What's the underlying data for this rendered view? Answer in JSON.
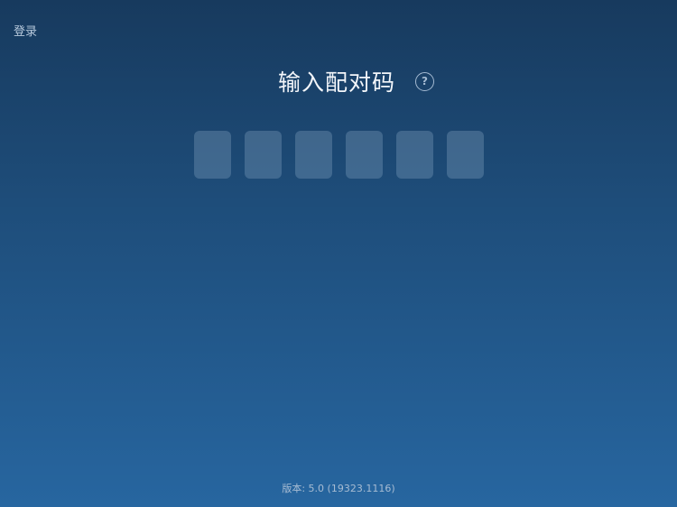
{
  "header": {
    "login_label": "登录"
  },
  "main": {
    "title": "输入配对码",
    "help_icon_text": "?",
    "help_icon": "question-circle-icon",
    "code_length": 6
  },
  "footer": {
    "version_text": "版本: 5.0 (19323.1116)"
  },
  "colors": {
    "background_top": "#173a5e",
    "background_bottom": "#2766a0",
    "code_box_fill": "rgba(140,170,200,0.32)"
  }
}
